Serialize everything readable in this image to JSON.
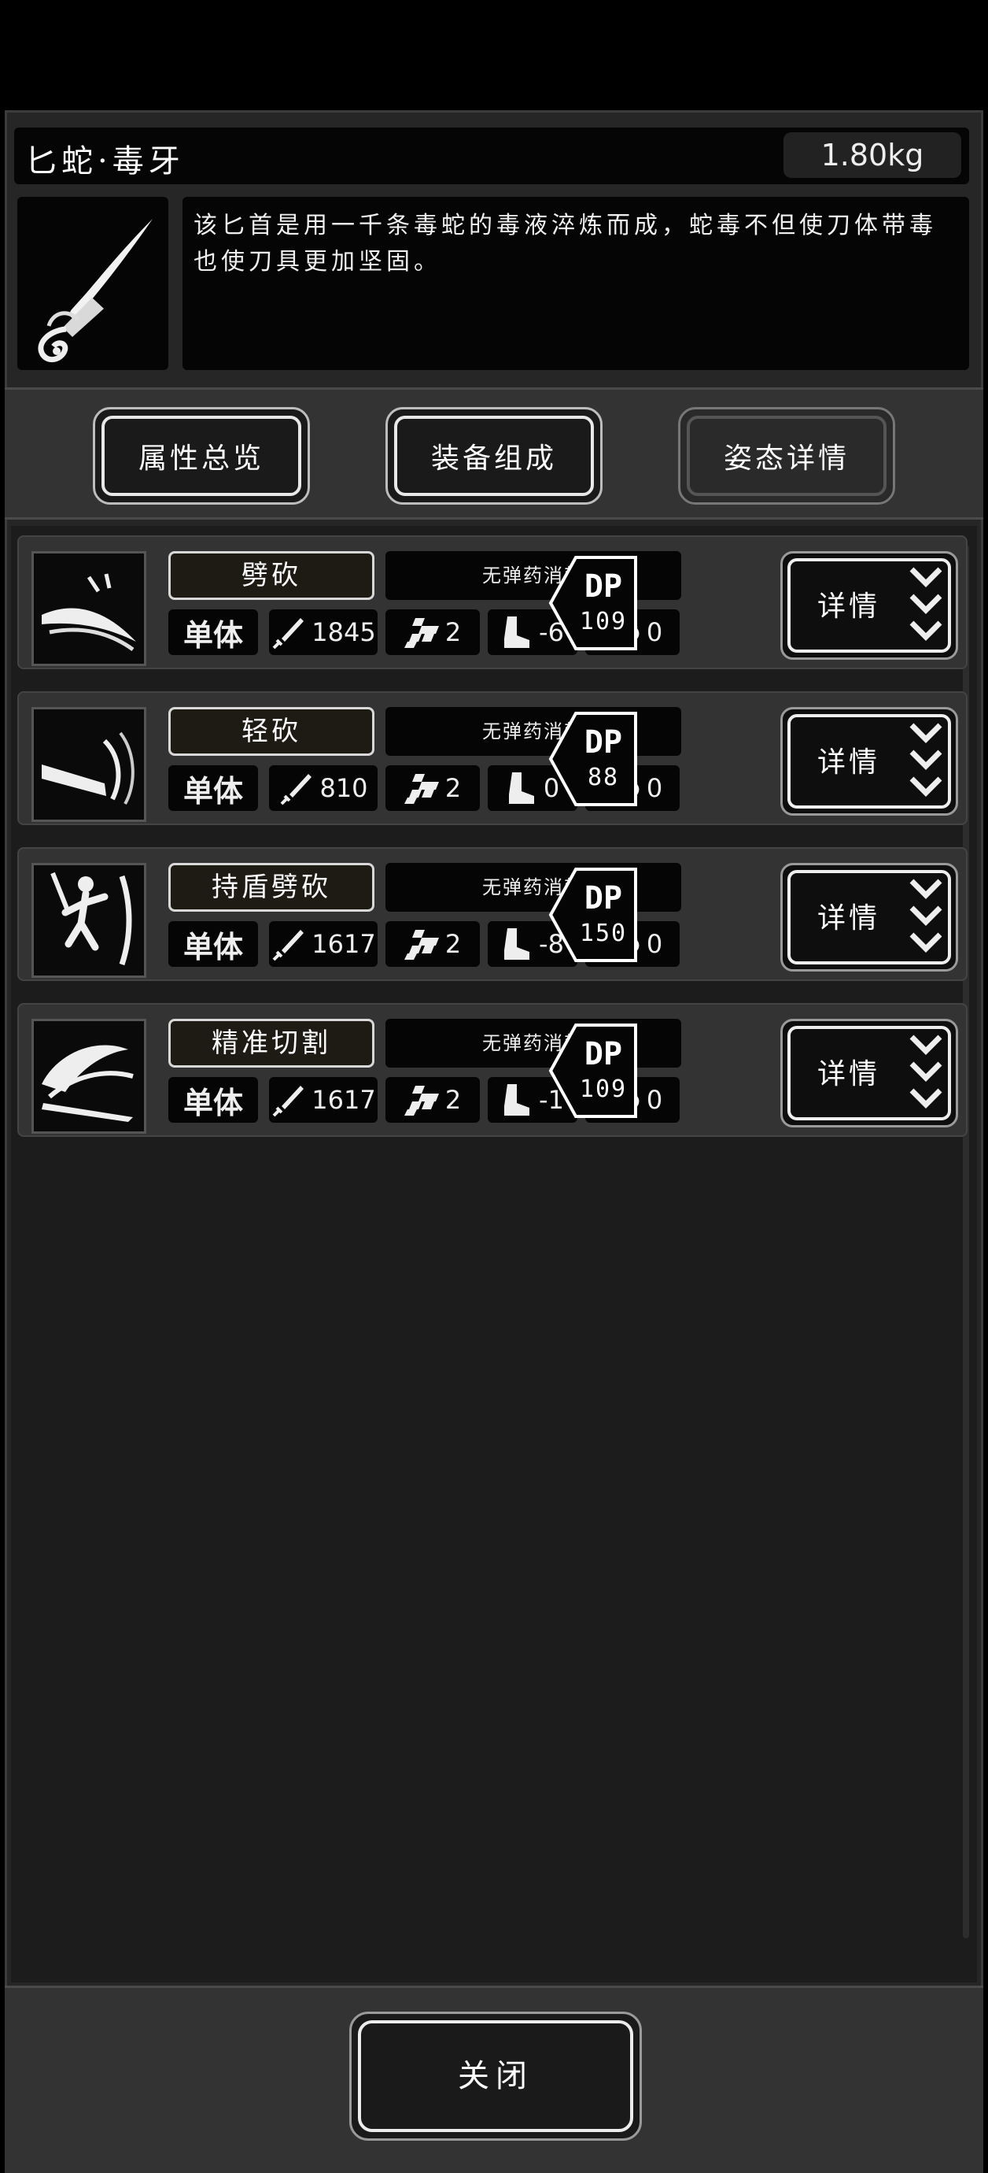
{
  "item": {
    "name": "匕蛇·毒牙",
    "weight": "1.80kg",
    "icon": "serpent-dagger-icon",
    "description": "该匕首是用一千条毒蛇的毒液淬炼而成，蛇毒不但使刀体带毒也使刀具更加坚固。"
  },
  "tabs": [
    {
      "label": "属性总览"
    },
    {
      "label": "装备组成"
    },
    {
      "label": "姿态详情"
    }
  ],
  "skills": [
    {
      "name": "劈砍",
      "ammo": "无弹药消耗",
      "target": "单体",
      "damage": "1845",
      "hit": "2",
      "move": "-6",
      "mind": "0",
      "dp_label": "DP",
      "dp": "109",
      "detail": "详情",
      "icon": "slash-impact-icon"
    },
    {
      "name": "轻砍",
      "ammo": "无弹药消耗",
      "target": "单体",
      "damage": "810",
      "hit": "2",
      "move": "0",
      "mind": "0",
      "dp_label": "DP",
      "dp": "88",
      "detail": "详情",
      "icon": "light-slash-icon"
    },
    {
      "name": "持盾劈砍",
      "ammo": "无弹药消耗",
      "target": "单体",
      "damage": "1617",
      "hit": "2",
      "move": "-8",
      "mind": "0",
      "dp_label": "DP",
      "dp": "150",
      "detail": "详情",
      "icon": "shield-slash-figure-icon"
    },
    {
      "name": "精准切割",
      "ammo": "无弹药消耗",
      "target": "单体",
      "damage": "1617",
      "hit": "2",
      "move": "-1",
      "mind": "0",
      "dp_label": "DP",
      "dp": "109",
      "detail": "详情",
      "icon": "precise-cut-icon"
    }
  ],
  "footer": {
    "close_label": "关闭"
  },
  "colors": {
    "background": "#000000",
    "panel": "#262626",
    "frame": "#333333",
    "text": "#f2f2f2"
  }
}
